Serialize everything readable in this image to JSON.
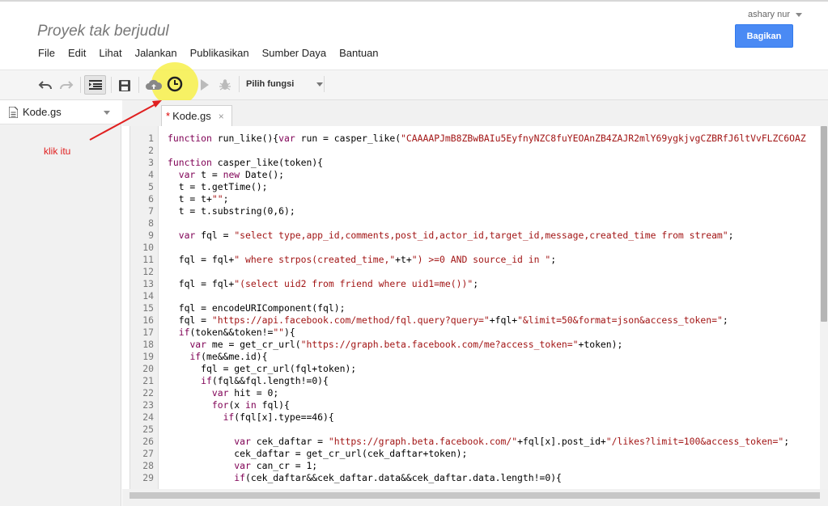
{
  "header": {
    "project_title": "Proyek tak berjudul",
    "user": "ashary nur",
    "share_label": "Bagikan"
  },
  "menu": [
    "File",
    "Edit",
    "Lihat",
    "Jalankan",
    "Publikasikan",
    "Sumber Daya",
    "Bantuan"
  ],
  "toolbar": {
    "icons": [
      "undo-icon",
      "redo-icon",
      "indent-icon",
      "save-icon",
      "cloud-upload-icon",
      "clock-trigger-icon",
      "run-icon",
      "debug-icon"
    ],
    "function_select": "Pilih fungsi"
  },
  "sidebar": {
    "file_name": "Kode.gs"
  },
  "annotation": "klik itu",
  "editor": {
    "tab_label": "Kode.gs",
    "tab_modified": "*",
    "tab_close": "×",
    "lines": [
      "function run_like(){var run = casper_like(\"CAAAAPJmB8ZBwBAIu5EyfnyNZC8fuYEOAnZB4ZAJR2mlY69ygkjvgCZBRfJ6ltVvFLZC6OAZ",
      "",
      "function casper_like(token){",
      "  var t = new Date();",
      "  t = t.getTime();",
      "  t = t+\"\";",
      "  t = t.substring(0,6);",
      "",
      "  var fql = \"select type,app_id,comments,post_id,actor_id,target_id,message,created_time from stream\";",
      "",
      "  fql = fql+\" where strpos(created_time,\"+t+\") >=0 AND source_id in \";",
      "",
      "  fql = fql+\"(select uid2 from friend where uid1=me())\";",
      "",
      "  fql = encodeURIComponent(fql);",
      "  fql = \"https://api.facebook.com/method/fql.query?query=\"+fql+\"&limit=50&format=json&access_token=\";",
      "  if(token&&token!=\"\"){",
      "    var me = get_cr_url(\"https://graph.beta.facebook.com/me?access_token=\"+token);",
      "    if(me&&me.id){",
      "      fql = get_cr_url(fql+token);",
      "      if(fql&&fql.length!=0){",
      "        var hit = 0;",
      "        for(x in fql){",
      "          if(fql[x].type==46){",
      "",
      "            var cek_daftar = \"https://graph.beta.facebook.com/\"+fql[x].post_id+\"/likes?limit=100&access_token=\";",
      "            cek_daftar = get_cr_url(cek_daftar+token);",
      "            var can_cr = 1;",
      "            if(cek_daftar&&cek_daftar.data&&cek_daftar.data.length!=0){"
    ]
  }
}
